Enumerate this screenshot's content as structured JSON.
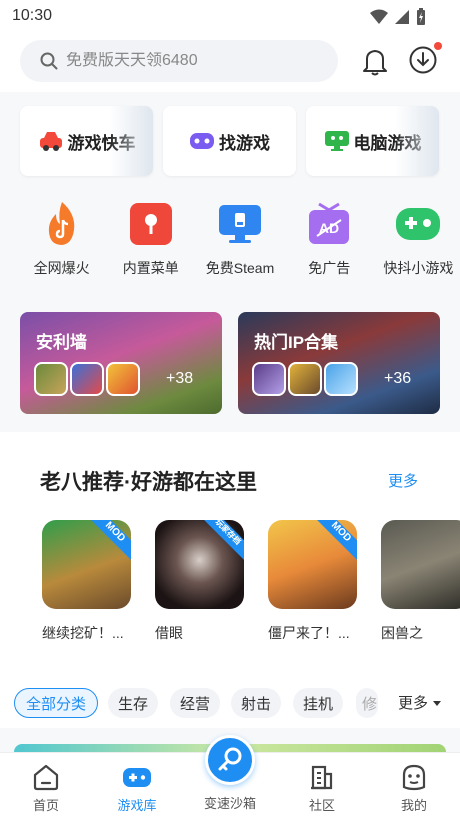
{
  "status": {
    "time": "10:30"
  },
  "search": {
    "placeholder": "免费版天天领6480"
  },
  "top_cards": [
    {
      "label": "游戏快车",
      "icon": "car-icon",
      "color": "#f2493b"
    },
    {
      "label": "找游戏",
      "icon": "gamepad-icon",
      "color": "#7b5cf0"
    },
    {
      "label": "电脑游戏",
      "icon": "monitor-game-icon",
      "color": "#2fb54a"
    }
  ],
  "features": [
    {
      "label": "全网爆火",
      "icon": "fire-tiktok-icon"
    },
    {
      "label": "内置菜单",
      "icon": "menu-pin-icon"
    },
    {
      "label": "免费Steam",
      "icon": "monitor-icon"
    },
    {
      "label": "免广告",
      "icon": "ad-free-icon"
    },
    {
      "label": "快抖小游戏",
      "icon": "mini-game-icon"
    }
  ],
  "collections": [
    {
      "title": "安利墙",
      "more": "+38"
    },
    {
      "title": "热门IP合集",
      "more": "+36"
    }
  ],
  "recommend": {
    "title": "老八推荐·好游都在这里",
    "more": "更多",
    "games": [
      {
        "name": "继续挖矿！...",
        "badge": "MOD"
      },
      {
        "name": "借眼",
        "badge": "玩家存档"
      },
      {
        "name": "僵尸来了！...",
        "badge": "MOD"
      },
      {
        "name": "困兽之",
        "badge": ""
      }
    ]
  },
  "categories": {
    "items": [
      "全部分类",
      "生存",
      "经营",
      "射击",
      "挂机",
      "修"
    ],
    "more": "更多"
  },
  "tabbar": {
    "items": [
      "首页",
      "游戏库",
      "变速沙箱",
      "社区",
      "我的"
    ],
    "active": "游戏库"
  },
  "colors": {
    "accent": "#1f8ef3",
    "notification": "#f24b3c"
  }
}
